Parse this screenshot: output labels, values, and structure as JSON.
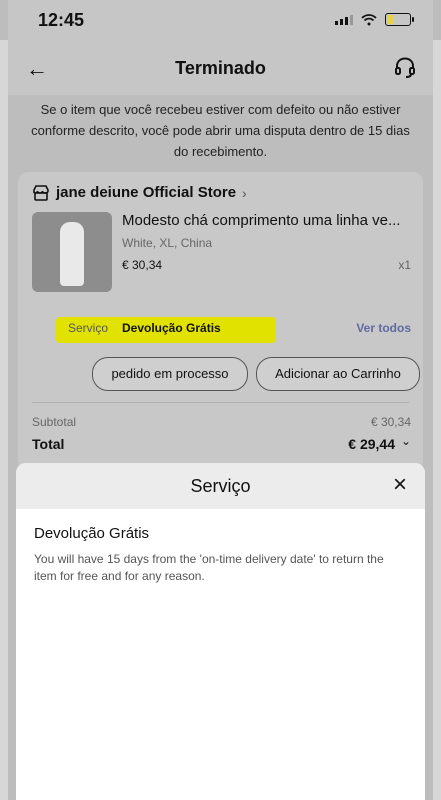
{
  "status_bar": {
    "time": "12:45"
  },
  "header": {
    "title": "Terminado"
  },
  "notice": "Se o item que você recebeu estiver com defeito ou não estiver conforme descrito, você pode abrir uma disputa dentro de 15 dias do recebimento.",
  "store": {
    "name": "jane deiune Official Store",
    "arrow": "›"
  },
  "product": {
    "title": "Modesto chá comprimento uma linha ve...",
    "variant": "White, XL, China",
    "price": "€ 30,34",
    "qty": "x1"
  },
  "service": {
    "label": "Serviço",
    "value": "Devolução Grátis",
    "link": "Ver todos"
  },
  "actions": {
    "btn1": "pedido em processo",
    "btn2": "Adicionar ao Carrinho"
  },
  "totals": {
    "subtotal_label": "Subtotal",
    "subtotal_value": "€ 30,34",
    "total_label": "Total",
    "total_value": "€ 29,44",
    "chevron": "⌄"
  },
  "sheet": {
    "title": "Serviço",
    "close_icon": "×",
    "heading": "Devolução Grátis",
    "body": "You will have 15 days from the 'on-time delivery date' to return the item for free and for any reason."
  }
}
